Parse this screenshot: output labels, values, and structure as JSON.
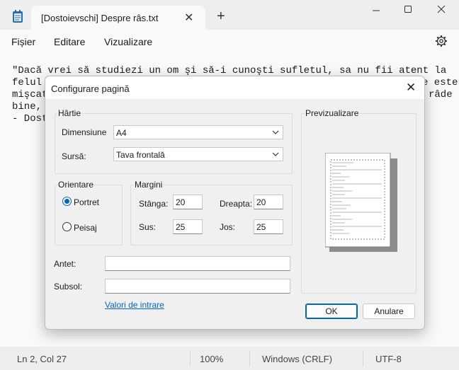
{
  "window": {
    "tab_title": "[Dostoievschi] Despre râs.txt",
    "icons": {
      "app": "notepad-icon",
      "close_tab": "close-icon",
      "new_tab": "plus-icon",
      "minimize": "minimize-icon",
      "maximize": "maximize-icon",
      "close": "close-icon"
    }
  },
  "menu": {
    "items": [
      "Fișier",
      "Editare",
      "Vizualizare"
    ],
    "settings_icon": "gear-icon"
  },
  "editor": {
    "lines": [
      "\"Dacă vrei să studiezi un om şi să-i cunoşti sufletul, sa nu fii atent la",
      "felul",
      "mişcat",
      "bine,",
      "- Dost"
    ],
    "line_tails": [
      "",
      "e este",
      "râde",
      "",
      ""
    ]
  },
  "status": {
    "position": "Ln 2, Col 27",
    "zoom": "100%",
    "line_ending": "Windows (CRLF)",
    "encoding": "UTF-8"
  },
  "dialog": {
    "title": "Configurare pagină",
    "paper": {
      "group_label": "Hârtie",
      "size_label": "Dimensiune",
      "size_value": "A4",
      "source_label": "Sursă:",
      "source_value": "Tava frontală"
    },
    "orientation": {
      "group_label": "Orientare",
      "portrait_label": "Portret",
      "landscape_label": "Peisaj",
      "selected": "Portret"
    },
    "margins": {
      "group_label": "Margini",
      "left_label": "Stânga:",
      "left_value": "20",
      "right_label": "Dreapta:",
      "right_value": "20",
      "top_label": "Sus:",
      "top_value": "25",
      "bottom_label": "Jos:",
      "bottom_value": "25"
    },
    "header_label": "Antet:",
    "header_value": "",
    "footer_label": "Subsol:",
    "footer_value": "",
    "link_label": "Valori de intrare",
    "preview_label": "Previzualizare",
    "ok_label": "OK",
    "cancel_label": "Anulare"
  },
  "colors": {
    "accent": "#0067c0",
    "link": "#0066cc"
  }
}
